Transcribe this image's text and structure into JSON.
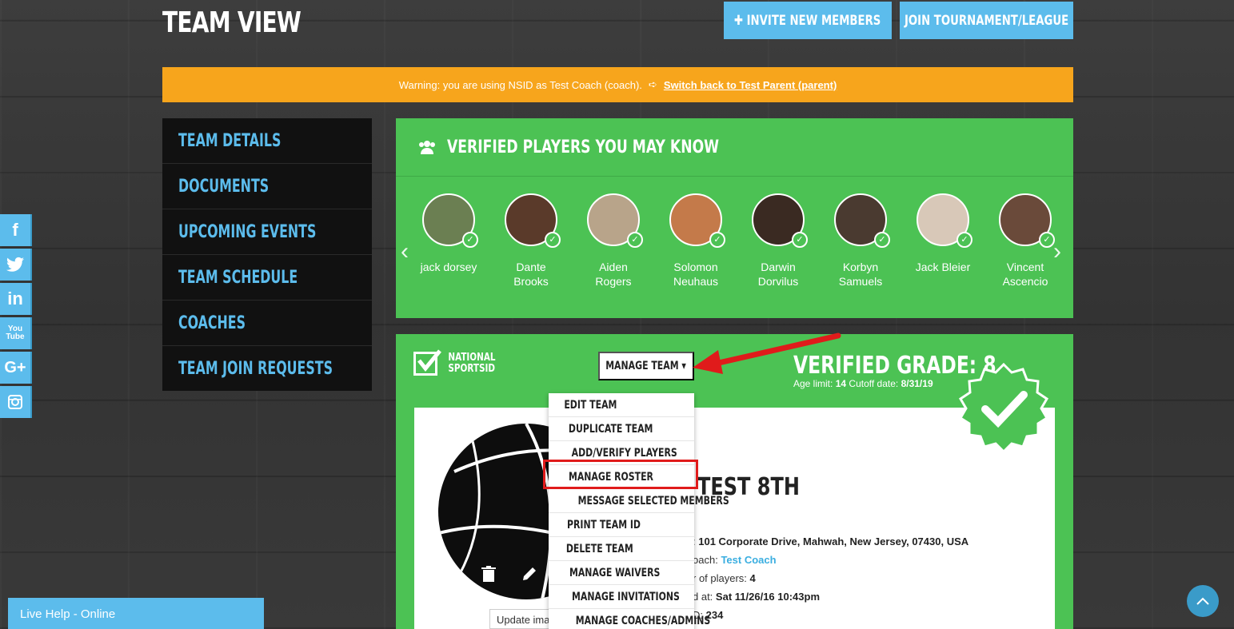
{
  "header": {
    "title": "TEAM VIEW",
    "invite_label": "INVITE NEW MEMBERS",
    "join_label": "JOIN TOURNAMENT/LEAGUE"
  },
  "warning": {
    "text": "Warning: you are using NSID as Test Coach (coach).",
    "link": "Switch back to Test Parent (parent)"
  },
  "sidebar": {
    "items": [
      {
        "label": "TEAM DETAILS"
      },
      {
        "label": "DOCUMENTS"
      },
      {
        "label": "UPCOMING EVENTS"
      },
      {
        "label": "TEAM SCHEDULE"
      },
      {
        "label": "COACHES"
      },
      {
        "label": "TEAM JOIN REQUESTS"
      }
    ]
  },
  "social": [
    "facebook-icon",
    "twitter-icon",
    "linkedin-icon",
    "youtube-icon",
    "google-plus-icon",
    "instagram-icon"
  ],
  "players": {
    "title": "VERIFIED PLAYERS YOU MAY KNOW",
    "list": [
      {
        "first": "jack dorsey",
        "last": "",
        "color": "#6b7f52"
      },
      {
        "first": "Dante",
        "last": "Brooks",
        "color": "#5a3a2a"
      },
      {
        "first": "Aiden",
        "last": "Rogers",
        "color": "#b8a48a"
      },
      {
        "first": "Solomon",
        "last": "Neuhaus",
        "color": "#c47a4a"
      },
      {
        "first": "Darwin",
        "last": "Dorvilus",
        "color": "#3a2a22"
      },
      {
        "first": "Korbyn",
        "last": "Samuels",
        "color": "#4a3a30"
      },
      {
        "first": "Jack Bleier",
        "last": "",
        "color": "#d8c8b8"
      },
      {
        "first": "Vincent",
        "last": "Ascencio",
        "color": "#6a4a3a"
      }
    ]
  },
  "team": {
    "logo_line1": "NATIONAL",
    "logo_line2": "SPORTSID",
    "manage_label": "MANAGE TEAM",
    "grade": "VERIFIED GRADE: 8",
    "age_label": "Age limit:",
    "age_value": "14",
    "cutoff_label": "Cutoff date:",
    "cutoff_value": "8/31/19",
    "name": "TEST 8TH",
    "address_value": "101 Corporate Drive, Mahwah, New Jersey, 07430, USA",
    "coach_label": "oach:",
    "coach_value": "Test Coach",
    "players_label": "r of players:",
    "players_value": "4",
    "created_label": "d at:",
    "created_value": "Sat 11/26/16 10:43pm",
    "id_label": "D:",
    "id_value": "234",
    "update_image": "Update image"
  },
  "dropdown": {
    "items": [
      "EDIT TEAM",
      "DUPLICATE TEAM",
      "ADD/VERIFY PLAYERS",
      "MANAGE ROSTER",
      "MESSAGE SELECTED MEMBERS",
      "PRINT TEAM ID",
      "DELETE TEAM",
      "MANAGE WAIVERS",
      "MANAGE INVITATIONS",
      "MANAGE COACHES/ADMINS"
    ]
  },
  "live_help": "Live Help - Online",
  "colors": {
    "accent": "#5cbcec",
    "green": "#4cc254",
    "warning": "#f7a51c",
    "highlight": "#e01b1b"
  }
}
